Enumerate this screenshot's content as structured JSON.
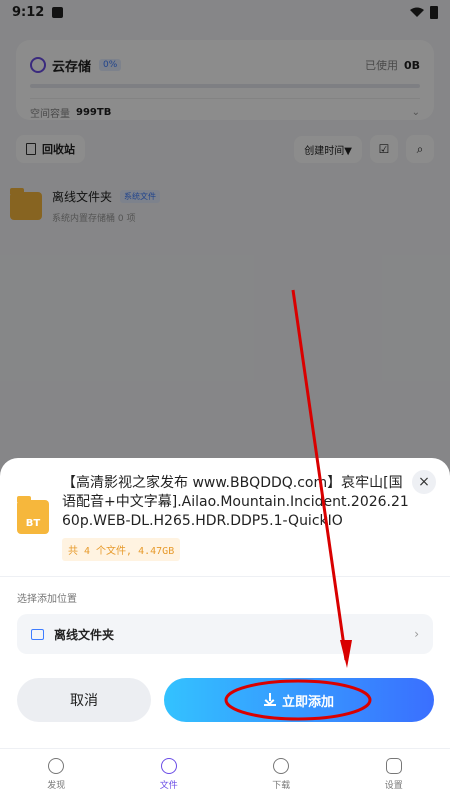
{
  "status_bar": {
    "time": "9:12"
  },
  "storage_card": {
    "title": "云存储",
    "percent": "0%",
    "used_label": "已使用",
    "used_value": "0B",
    "space_label": "空间容量",
    "space_value": "999TB"
  },
  "toolbar": {
    "recycle_label": "回收站",
    "sort_label": "创建时间▼"
  },
  "background_folder": {
    "title": "离线文件夹",
    "tag": "系统文件",
    "subtitle": "系统内置存储桶   0 项"
  },
  "sheet": {
    "file_icon_label": "BT",
    "task_name": "【高清影视之家发布 www.BBQDDQ.com】哀牢山[国语配音+中文字幕].Ailao.Mountain.Incident.2026.2160p.WEB-DL.H265.HDR.DDP5.1-QuickIO",
    "task_meta": "共 4 个文件, 4.47GB",
    "section_label": "选择添加位置",
    "location_label": "离线文件夹",
    "cancel_label": "取消",
    "confirm_label": "立即添加"
  },
  "tabs": [
    {
      "label": "发现",
      "icon": "compass-icon"
    },
    {
      "label": "文件",
      "icon": "cloud-icon",
      "active": true
    },
    {
      "label": "下载",
      "icon": "download-icon"
    },
    {
      "label": "设置",
      "icon": "gear-icon"
    }
  ],
  "colors": {
    "accent": "#6b4de6",
    "primary_gradient_start": "#33c2ff",
    "primary_gradient_end": "#3a6fff",
    "annotation": "#d90000"
  }
}
